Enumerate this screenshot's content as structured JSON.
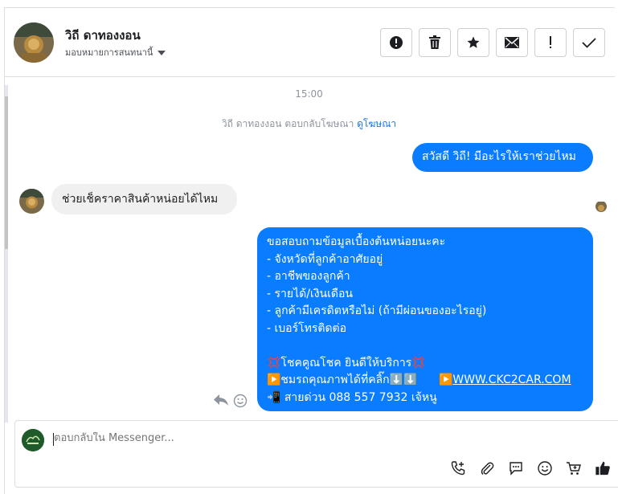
{
  "header": {
    "contact_name": "วิถี ดาทองงอน",
    "assign_label": "มอบหมายการสนทนานี้",
    "actions": [
      {
        "name": "spam-button",
        "icon": "alert-circle-icon"
      },
      {
        "name": "delete-button",
        "icon": "trash-icon"
      },
      {
        "name": "star-button",
        "icon": "star-icon"
      },
      {
        "name": "mark-unread-button",
        "icon": "envelope-icon"
      },
      {
        "name": "follow-up-button",
        "icon": "exclamation-icon"
      },
      {
        "name": "done-button",
        "icon": "check-icon"
      }
    ]
  },
  "thread": {
    "timestamp": "15:00",
    "ad_note_text": "วิถี ดาทองงอน ตอบกลับโฆษณา",
    "ad_note_link": "ดูโฆษณา",
    "messages": {
      "out1": "สวัสดี วิถี! มีอะไรให้เราช่วยไหม",
      "in1": "ช่วยเช็คราคาสินค้าหน่อยได้ไหม",
      "out2_lines": [
        "ขอสอบถามข้อมูลเบื้องต้นหน่อยนะคะ",
        "- จังหวัดที่ลูกค้าอาศัยอยู่",
        "- อาชีพของลูกค้า",
        "- รายได้/เงินเดือน",
        "- ลูกค้ามีเครดิตหรือไม่ (ถ้ามีผ่อนของอะไรอยู่)",
        "- เบอร์โทรติดต่อ",
        "",
        "💢โชคคูณโชค ยินดีให้บริการ💢",
        "▶️ชมรถคุณภาพได้ที่คลิ๊ก⬇️⬇️ ",
        "📲 สายด่วน 088 557 7932 เจ้หนู"
      ],
      "out2_link_prefix": "▶️",
      "out2_link": "WWW.CKC2CAR.COM"
    }
  },
  "composer": {
    "placeholder": "ตอบกลับใน Messenger...",
    "tools": [
      "phone-plus-icon",
      "paperclip-icon",
      "chat-bubble-icon",
      "smiley-icon",
      "cart-plus-icon",
      "thumbs-up-icon"
    ]
  },
  "colors": {
    "accent": "#0a7cff",
    "link": "#1877f2",
    "incoming_bubble": "#f0f0f0"
  }
}
